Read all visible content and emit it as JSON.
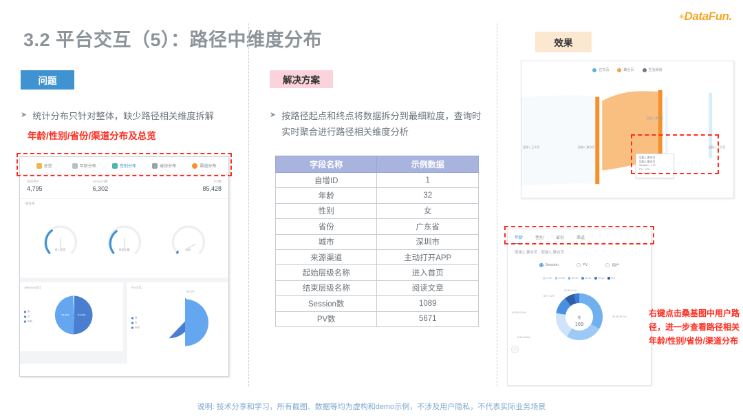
{
  "logo": {
    "mark": "✳",
    "text": "DataFun",
    "dot": "."
  },
  "title": "3.2 平台交互（5）：路径中维度分布",
  "sections": {
    "problem_label": "问题",
    "solution_label": "解决方案",
    "effect_label": "效果"
  },
  "problem": {
    "bullet": "统计分布只针对整体，缺少路径相关维度拆解",
    "red_label": "年龄/性别/省份/渠道分布及总览"
  },
  "solution": {
    "bullet": "按路径起点和终点将数据拆分到最细粒度，查询时实时聚合进行路径相关维度分析"
  },
  "dashboard": {
    "tabs": [
      {
        "label": "总览",
        "icon": "overview-icon",
        "active": false
      },
      {
        "label": "年龄分布",
        "icon": "age-icon",
        "active": false
      },
      {
        "label": "性别分布",
        "icon": "gender-icon",
        "active": true
      },
      {
        "label": "省份分布",
        "icon": "province-icon",
        "active": false
      },
      {
        "label": "渠道分布",
        "icon": "channel-icon",
        "active": false
      }
    ],
    "metrics": [
      {
        "label": "访问用户",
        "value": "4,795"
      },
      {
        "label": "Session数",
        "value": "6,302"
      },
      {
        "label": "PV数",
        "value": "85,428"
      }
    ],
    "gauge_panel_label": "转化率",
    "gauges": [
      {
        "label": "进入首页",
        "pct": 62
      },
      {
        "label": "阅读文章",
        "pct": 58
      },
      {
        "label": "转化",
        "pct": 8
      }
    ],
    "pies": [
      {
        "label": "Session占比",
        "legend": [
          "男",
          "女",
          "未知"
        ],
        "slices": [
          51.9,
          46.8,
          1.3
        ],
        "labels": [
          "51.9%",
          "46.8%"
        ]
      },
      {
        "label": "PV占比",
        "legend": [
          "男",
          "女",
          "未知"
        ],
        "slices": [
          54.3,
          43.2,
          2.5
        ],
        "labels": [
          "54.3%",
          "43.2%"
        ]
      }
    ]
  },
  "table": {
    "headers": [
      "字段名称",
      "示例数据"
    ],
    "rows": [
      [
        "自增ID",
        "1"
      ],
      [
        "年龄",
        "32"
      ],
      [
        "性别",
        "女"
      ],
      [
        "省份",
        "广东省"
      ],
      [
        "城市",
        "深圳市"
      ],
      [
        "来源渠道",
        "主动打开APP"
      ],
      [
        "起始层级名称",
        "进入首页"
      ],
      [
        "结束层级名称",
        "阅读文章"
      ],
      [
        "Session数",
        "1089"
      ],
      [
        "PV数",
        "5671"
      ]
    ]
  },
  "sankey": {
    "legend": [
      {
        "label": "正文页",
        "color": "#56b8d6"
      },
      {
        "label": "聚合页",
        "color": "#f5a04a"
      },
      {
        "label": "生活频道",
        "color": "#707a82"
      }
    ],
    "node_labels": [
      "层级1_正文页",
      "层级2_聚合页",
      "层级3_聚合页",
      "层级4_正文页"
    ],
    "tooltip": {
      "from": "层级2_聚合页",
      "to": "层级3_聚合页",
      "session": "Session：170",
      "pv": "PV：170",
      "user": "User：169"
    }
  },
  "detail": {
    "tabs": [
      {
        "label": "年龄",
        "active": true
      },
      {
        "label": "性别",
        "active": false
      },
      {
        "label": "省份",
        "active": false
      },
      {
        "label": "渠道",
        "active": false
      }
    ],
    "breadcrumb": "层级2_聚合页 - 层级3_聚合页",
    "radios": [
      {
        "label": "Session",
        "selected": true
      },
      {
        "label": "PV",
        "selected": false
      },
      {
        "label": "用户",
        "selected": false
      }
    ],
    "donut": {
      "center_title": "量",
      "center_value": "169",
      "legend": [
        "0-20",
        "20-30",
        "30-40",
        "40-50",
        "50-60",
        "60+"
      ],
      "colors": [
        "#cfe4fa",
        "#9cc9f5",
        "#6fb0ef",
        "#4a90e2",
        "#3b7cd4",
        "#2c5fa8"
      ],
      "labels": [
        "0-20:16.6%",
        "30-40:33.7%",
        "40-50:15.4%",
        "50-60:2.4%",
        "60+:7.1%"
      ],
      "values": [
        16.6,
        24.8,
        33.7,
        15.4,
        2.4,
        7.1
      ]
    },
    "next_icon": "chevron-right-icon"
  },
  "annotation": "右键点击桑基图中用户路径，进一步查看路径相关年龄/性别/省份/渠道分布",
  "footer": "说明: 技术分享和学习，所有截图、数据等均为虚构和demo示例，不涉及用户隐私，不代表实际业务场景",
  "colors": {
    "blue": "#3f93d1",
    "pink": "#fbd3dd",
    "peach": "#fce8d0",
    "red": "#ff2d20",
    "orange": "#f5a04a"
  }
}
